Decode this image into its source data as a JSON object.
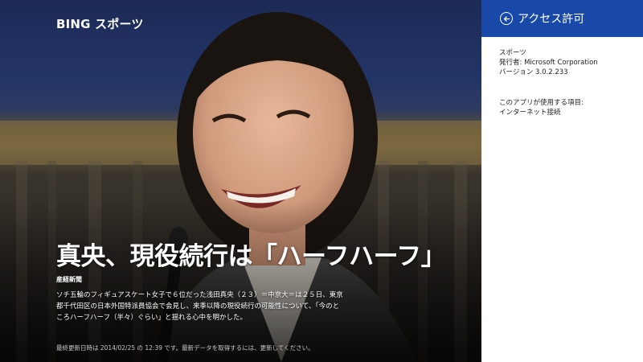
{
  "app": {
    "title": "BING スポーツ"
  },
  "article": {
    "headline": "真央、現役続行は「ハーフハーフ」",
    "source": "産経新聞",
    "body": "ソチ五輪のフィギュアスケート女子で６位だった浅田真央（２３）＝中京大＝は２５日、東京都千代田区の日本外国特派員協会で会見し、来季以降の現役続行の可能性について、「今のところハーフハーフ（半々）ぐらい」と揺れる心中を明かした。",
    "updated": "最終更新日時は 2014/02/25 の 12:39 です。最新データを取得するには、更新してください。"
  },
  "panel": {
    "title": "アクセス許可",
    "back_icon": "back-arrow-circle-icon",
    "app_name": "スポーツ",
    "publisher": "発行者: Microsoft Corporation",
    "version": "バージョン 3.0.2.233",
    "permissions_heading": "このアプリが使用する項目:",
    "permissions": [
      "インターネット接続"
    ]
  },
  "colors": {
    "panel_header": "#1849a9",
    "panel_background": "#ffffff",
    "text_light": "#ffffff"
  }
}
